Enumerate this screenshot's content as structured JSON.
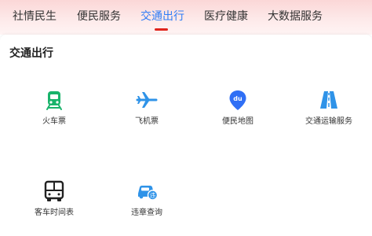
{
  "tabs": [
    {
      "label": "社情民生",
      "active": false
    },
    {
      "label": "便民服务",
      "active": false
    },
    {
      "label": "交通出行",
      "active": true
    },
    {
      "label": "医疗健康",
      "active": false
    },
    {
      "label": "大数据服务",
      "active": false
    }
  ],
  "section": {
    "title": "交通出行"
  },
  "items": [
    {
      "label": "火车票",
      "icon": "train-icon",
      "color": "#19b36b"
    },
    {
      "label": "飞机票",
      "icon": "airplane-icon",
      "color": "#2f93e8"
    },
    {
      "label": "便民地图",
      "icon": "map-pin-icon",
      "icon_text": "du",
      "color": "#2f6ff5"
    },
    {
      "label": "交通运输服务",
      "icon": "road-icon",
      "color": "#2f93e8"
    },
    {
      "label": "客车时间表",
      "icon": "bus-icon",
      "color": "#222222"
    },
    {
      "label": "违章查询",
      "icon": "car-inquiry-icon",
      "icon_text": "违",
      "color": "#2f93e8"
    }
  ],
  "colors": {
    "accent": "#2f7df6",
    "indicator": "#e0241c"
  }
}
